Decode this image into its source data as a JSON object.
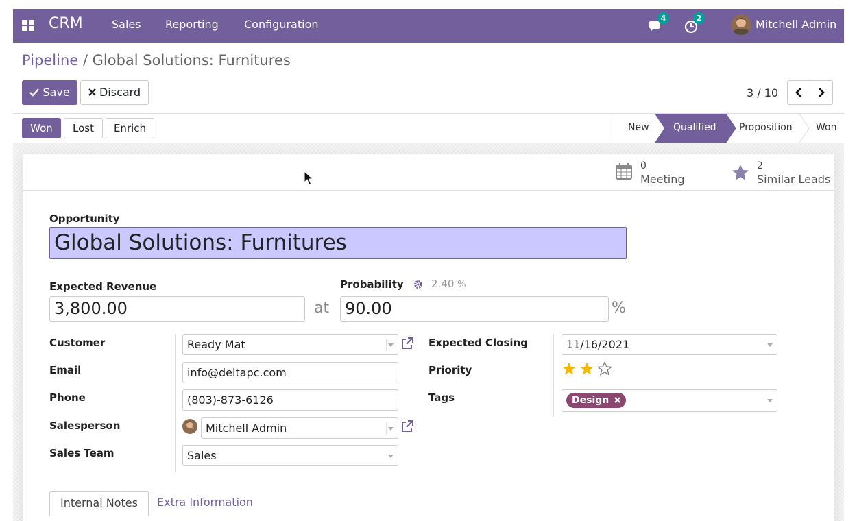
{
  "navbar": {
    "app_name": "CRM",
    "menu": [
      "Sales",
      "Reporting",
      "Configuration"
    ],
    "messages_badge": "4",
    "activities_badge": "2",
    "user_name": "Mitchell Admin",
    "icons": [
      "apps-icon",
      "chat-icon",
      "clock-icon",
      "avatar"
    ],
    "accent_color": "#725f9c",
    "badge_color": "#00a09d"
  },
  "breadcrumb": {
    "parent": "Pipeline",
    "separator": " / ",
    "current": "Global Solutions: Furnitures"
  },
  "toolbar": {
    "save_label": "Save",
    "discard_label": "Discard",
    "pager_value": "3 / 10"
  },
  "statusbar": {
    "won_label": "Won",
    "lost_label": "Lost",
    "enrich_label": "Enrich",
    "stages": [
      "New",
      "Qualified",
      "Proposition",
      "Won"
    ],
    "active_stage": "Qualified"
  },
  "smart_buttons": {
    "meeting_count": "0",
    "meeting_label": "Meeting",
    "similar_count": "2",
    "similar_label": "Similar Leads"
  },
  "form": {
    "opportunity_label": "Opportunity",
    "opportunity_name": "Global Solutions: Furnitures",
    "expected_revenue_label": "Expected Revenue",
    "expected_revenue": "3,800.00",
    "at_label": "at",
    "probability_label": "Probability",
    "auto_probability": "2.40",
    "auto_probability_unit": "%",
    "probability": "90.00",
    "percent": "%",
    "customer_label": "Customer",
    "customer": "Ready Mat",
    "email_label": "Email",
    "email": "info@deltapc.com",
    "phone_label": "Phone",
    "phone": "(803)-873-6126",
    "salesperson_label": "Salesperson",
    "salesperson": "Mitchell Admin",
    "sales_team_label": "Sales Team",
    "sales_team": "Sales",
    "expected_closing_label": "Expected Closing",
    "expected_closing": "11/16/2021",
    "priority_label": "Priority",
    "priority_stars": 2,
    "priority_max": 3,
    "tags_label": "Tags",
    "tags": [
      "Design"
    ],
    "tag_color": "#8b4770"
  },
  "tabs": {
    "internal_notes": "Internal Notes",
    "extra_information": "Extra Information"
  }
}
